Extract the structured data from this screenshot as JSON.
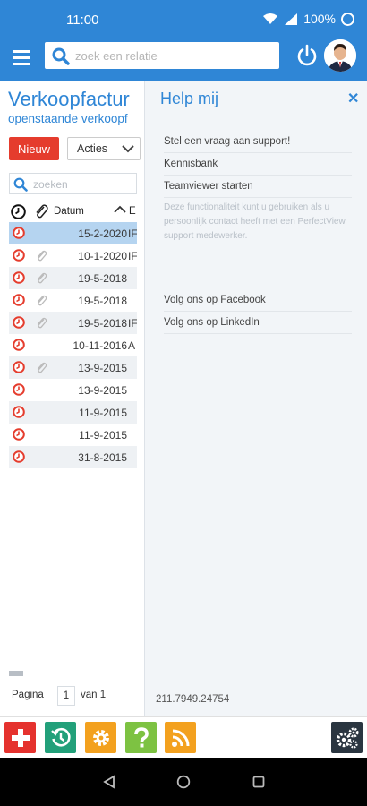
{
  "status_bar": {
    "time": "11:00",
    "battery": "100%"
  },
  "header": {
    "search_placeholder": "zoek een relatie"
  },
  "list_panel": {
    "title": "Verkoopfactur",
    "subtitle": "openstaande verkoopf",
    "new_button": "Nieuw",
    "actions_button": "Acties",
    "search_placeholder": "zoeken",
    "column_date": "Datum",
    "column_e": "E",
    "rows": [
      {
        "date": "15-2-2020",
        "extra": "IF",
        "attachment": false,
        "selected": true
      },
      {
        "date": "10-1-2020",
        "extra": "IF",
        "attachment": true,
        "selected": false
      },
      {
        "date": "19-5-2018",
        "extra": "",
        "attachment": true,
        "selected": false
      },
      {
        "date": "19-5-2018",
        "extra": "",
        "attachment": true,
        "selected": false
      },
      {
        "date": "19-5-2018",
        "extra": "IF",
        "attachment": true,
        "selected": false
      },
      {
        "date": "10-11-2016",
        "extra": "A",
        "attachment": false,
        "selected": false
      },
      {
        "date": "13-9-2015",
        "extra": "",
        "attachment": true,
        "selected": false
      },
      {
        "date": "13-9-2015",
        "extra": "",
        "attachment": false,
        "selected": false
      },
      {
        "date": "11-9-2015",
        "extra": "",
        "attachment": false,
        "selected": false
      },
      {
        "date": "11-9-2015",
        "extra": "",
        "attachment": false,
        "selected": false
      },
      {
        "date": "31-8-2015",
        "extra": "",
        "attachment": false,
        "selected": false
      }
    ],
    "pager": {
      "label": "Pagina",
      "page": "1",
      "of": "van 1"
    }
  },
  "help_panel": {
    "title": "Help mij",
    "items": [
      "Stel een vraag aan support!",
      "Kennisbank",
      "Teamviewer starten"
    ],
    "note": "Deze functionaliteit kunt u gebruiken als u persoonlijk contact heeft met een PerfectView support medewerker.",
    "social": [
      "Volg ons op Facebook",
      "Volg ons op LinkedIn"
    ],
    "number": "211.7949.24754"
  },
  "bottom_bar": {
    "tiles": [
      {
        "icon": "plus-icon",
        "color": "#e5322e"
      },
      {
        "icon": "history-icon",
        "color": "#22a07a"
      },
      {
        "icon": "gear-icon",
        "color": "#f3a11f"
      },
      {
        "icon": "question-icon",
        "color": "#7dc242"
      },
      {
        "icon": "rss-icon",
        "color": "#f3a11f"
      }
    ],
    "settings_tile": {
      "icon": "cogs-icon",
      "color": "#2a3540"
    }
  },
  "colors": {
    "primary": "#2f86d6",
    "danger": "#e53c2d",
    "selected_row": "#b5d4f0"
  }
}
